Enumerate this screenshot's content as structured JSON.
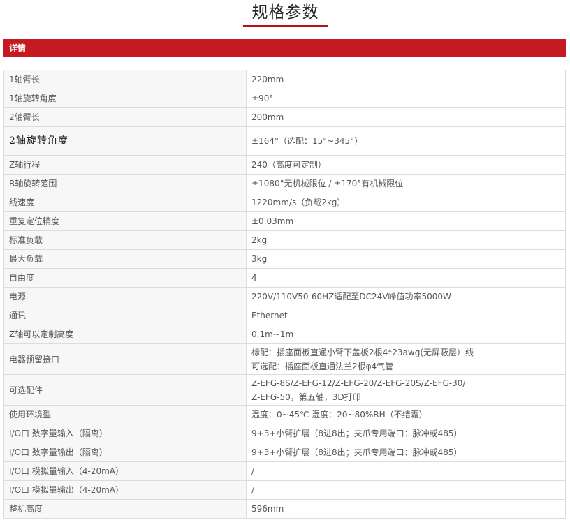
{
  "heading": "规格参数",
  "section_label": "详情",
  "specs": [
    {
      "key": "1轴臂长",
      "value": "220mm"
    },
    {
      "key": "1轴旋转角度",
      "value": "±90°"
    },
    {
      "key": "2轴臂长",
      "value": "200mm"
    },
    {
      "key": "2轴旋转角度",
      "value": "±164°（选配：15°~345°）"
    },
    {
      "key": "Z轴行程",
      "value": "240（高度可定制）"
    },
    {
      "key": "R轴旋转范围",
      "value": "±1080°无机械限位 / ±170°有机械限位"
    },
    {
      "key": "线速度",
      "value": "1220mm/s（负载2kg）"
    },
    {
      "key": "重复定位精度",
      "value": "±0.03mm"
    },
    {
      "key": "标准负载",
      "value": "2kg"
    },
    {
      "key": "最大负载",
      "value": "3kg"
    },
    {
      "key": "自由度",
      "value": "4"
    },
    {
      "key": "电源",
      "value": "220V/110V50-60HZ适配至DC24V峰值功率5000W"
    },
    {
      "key": "通讯",
      "value": "Ethernet"
    },
    {
      "key": "Z轴可以定制高度",
      "value": "0.1m~1m"
    },
    {
      "key": "电器预留接口",
      "value_lines": [
        "标配：插座面板直通小臂下盖板2根4*23awg(无屏蔽层）线",
        "可选配：插座面板直通法兰2根φ4气管"
      ]
    },
    {
      "key": "可选配件",
      "value_lines": [
        "Z-EFG-8S/Z-EFG-12/Z-EFG-20/Z-EFG-20S/Z-EFG-30/",
        "Z-EFG-50，第五轴，3D打印"
      ]
    },
    {
      "key": "使用环境型",
      "value": "温度：0~45℃ 湿度：20~80%RH（不结霜）"
    },
    {
      "key": "I/O口 数字量输入（隔离）",
      "value": "9+3+小臂扩展（8进8出；夹爪专用端口：脉冲或485）"
    },
    {
      "key": "I/O口 数字量输出（隔离）",
      "value": "9+3+小臂扩展（8进8出；夹爪专用端口：脉冲或485）"
    },
    {
      "key": "I/O口 模拟量输入（4-20mA）",
      "value": "/"
    },
    {
      "key": "I/O口 模拟量输出（4-20mA）",
      "value": "/"
    },
    {
      "key": "整机高度",
      "value": "596mm"
    }
  ],
  "colors": {
    "accent": "#c51a1f",
    "title_underline": "#b5121b",
    "key_cell_bg": "#f7f7f7",
    "border": "#dcdcdc"
  }
}
